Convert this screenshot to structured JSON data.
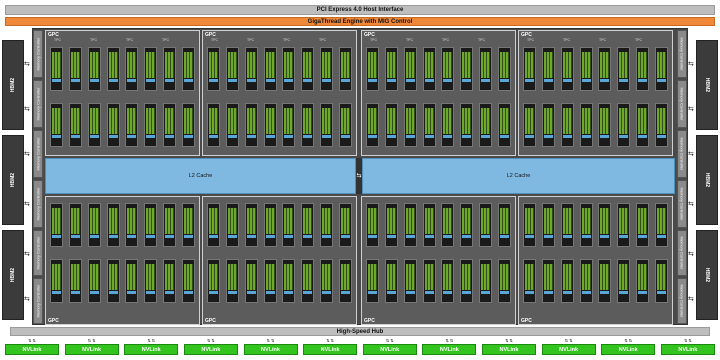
{
  "header": {
    "pcie": "PCI Express 4.0 Host Interface",
    "gigathread": "GigaThread Engine with MIG Control"
  },
  "gpc_label": "GPC",
  "tpc_label": "TPC",
  "l2_cache": {
    "left": "L2 Cache",
    "right": "L2 Cache"
  },
  "memory_controller_label": "Memory Controller",
  "hbm_label": "HBM2",
  "hub": "High-Speed Hub",
  "nvlink": {
    "label": "NVLink",
    "count": 12
  },
  "colors": {
    "pcie": "#bdbdbd",
    "gigathread": "#f0883a",
    "l2": "#7fb8e0",
    "nvlink": "#34c41f",
    "sm_core": "#6fa82c"
  }
}
